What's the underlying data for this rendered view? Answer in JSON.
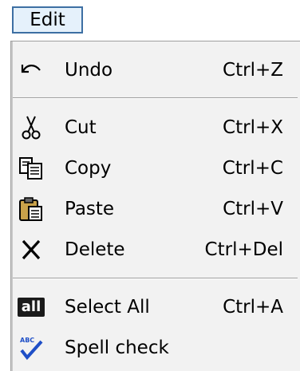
{
  "menubar": {
    "title": "Edit"
  },
  "menu": {
    "items": [
      {
        "label": "Undo",
        "shortcut": "Ctrl+Z",
        "icon": "undo-icon"
      },
      {
        "label": "Cut",
        "shortcut": "Ctrl+X",
        "icon": "scissors-icon"
      },
      {
        "label": "Copy",
        "shortcut": "Ctrl+C",
        "icon": "copy-icon"
      },
      {
        "label": "Paste",
        "shortcut": "Ctrl+V",
        "icon": "paste-icon"
      },
      {
        "label": "Delete",
        "shortcut": "Ctrl+Del",
        "icon": "delete-x-icon"
      },
      {
        "label": "Select All",
        "shortcut": "Ctrl+A",
        "icon": "select-all-icon",
        "icon_text": "all"
      },
      {
        "label": "Spell check",
        "shortcut": "",
        "icon": "spell-check-icon",
        "icon_text": "ABC"
      }
    ]
  },
  "colors": {
    "menu_bg": "#f2f2f2",
    "title_highlight": "#e5f1fb",
    "title_border": "#3d6fa3",
    "check_blue": "#1f4fc7"
  }
}
